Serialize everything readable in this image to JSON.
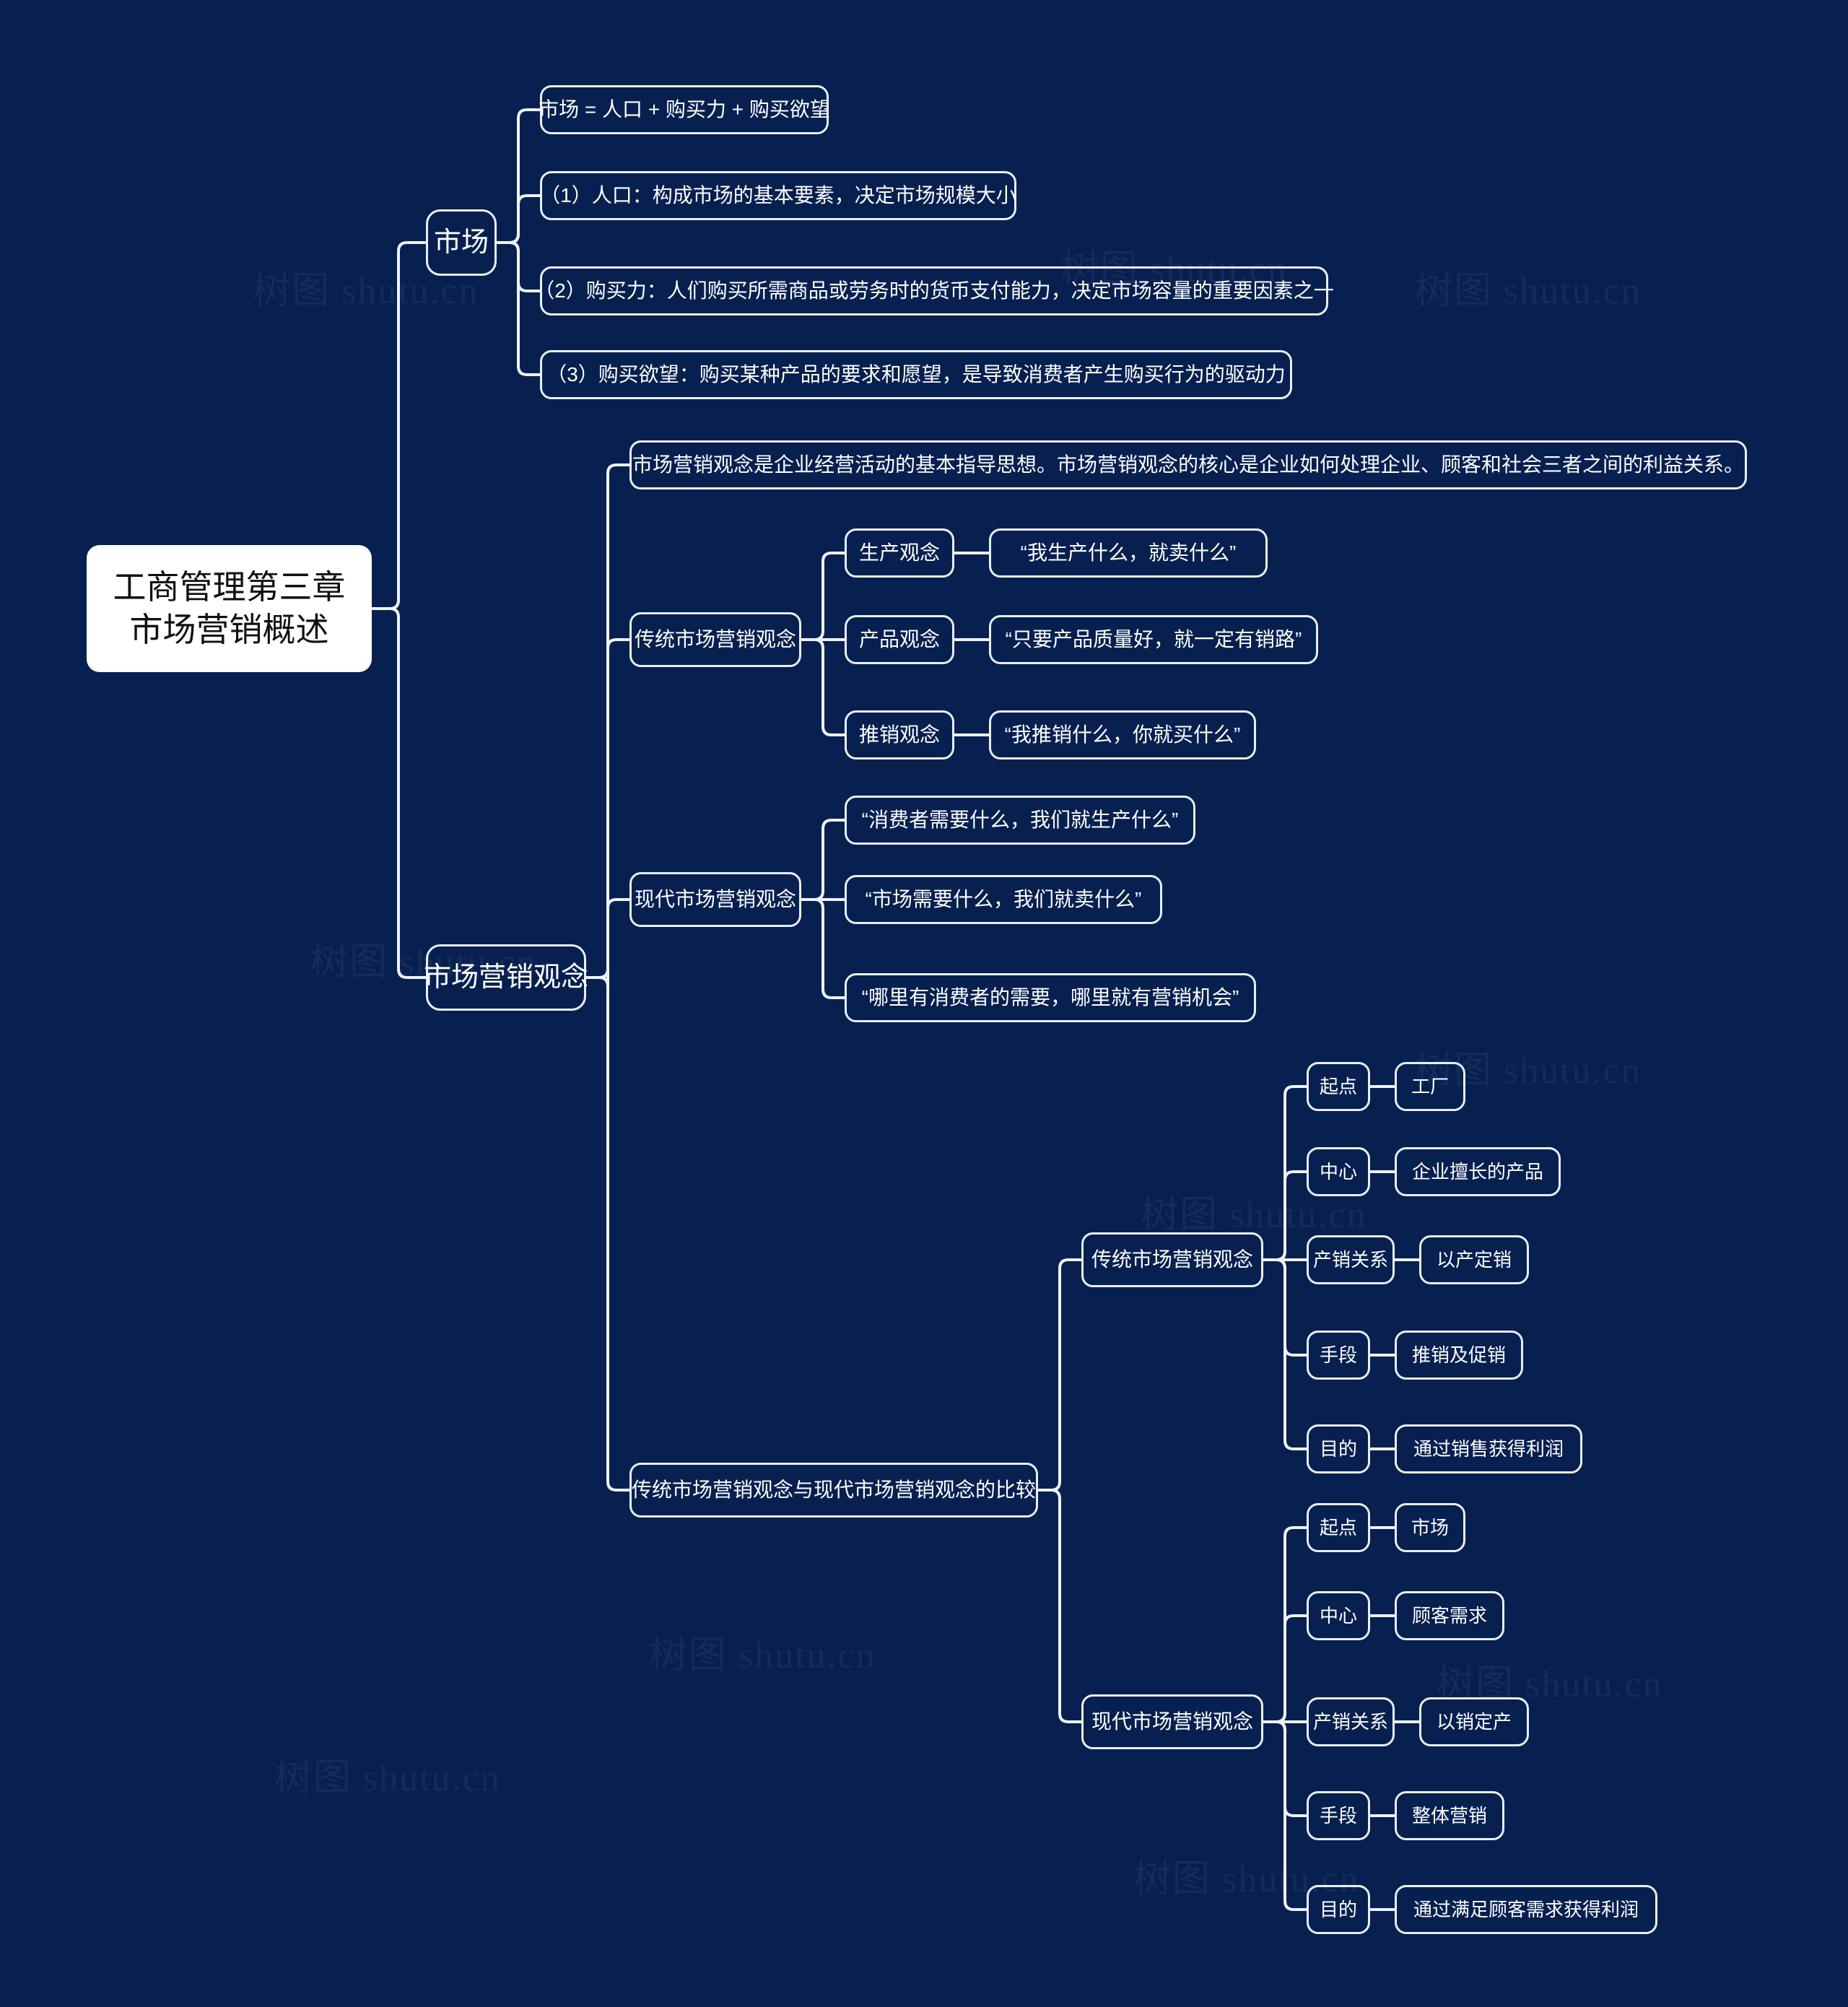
{
  "meta": {
    "background_color": "#07204f",
    "node_border_color": "#e9eef6",
    "node_text_color": "#ffffff",
    "root_background_color": "#ffffff",
    "root_text_color": "#111111",
    "watermark_text": "树图 shutu.cn"
  },
  "root": {
    "line1": "工商管理第三章",
    "line2": "市场营销概述"
  },
  "branches": {
    "market": {
      "label": "市场",
      "children": [
        {
          "label": "市场 = 人口 + 购买力 + 购买欲望"
        },
        {
          "label": "（1）人口：构成市场的基本要素，决定市场规模大小"
        },
        {
          "label": "（2）购买力：人们购买所需商品或劳务时的货币支付能力，决定市场容量的重要因素之一"
        },
        {
          "label": "（3）购买欲望：购买某种产品的要求和愿望，是导致消费者产生购买行为的驱动力"
        }
      ]
    },
    "marketing_concept": {
      "label": "市场营销观念",
      "definition": "市场营销观念是企业经营活动的基本指导思想。市场营销观念的核心是企业如何处理企业、顾客和社会三者之间的利益关系。",
      "traditional": {
        "label": "传统市场营销观念",
        "items": [
          {
            "name": "生产观念",
            "slogan": "“我生产什么，就卖什么”"
          },
          {
            "name": "产品观念",
            "slogan": "“只要产品质量好，就一定有销路”"
          },
          {
            "name": "推销观念",
            "slogan": "“我推销什么，你就买什么”"
          }
        ]
      },
      "modern": {
        "label": "现代市场营销观念",
        "slogans": [
          "“消费者需要什么，我们就生产什么”",
          "“市场需要什么，我们就卖什么”",
          "“哪里有消费者的需要，哪里就有营销机会”"
        ]
      },
      "comparison": {
        "label": "传统市场营销观念与现代市场营销观念的比较",
        "traditional": {
          "label": "传统市场营销观念",
          "rows": [
            {
              "key": "起点",
              "value": "工厂"
            },
            {
              "key": "中心",
              "value": "企业擅长的产品"
            },
            {
              "key": "产销关系",
              "value": "以产定销"
            },
            {
              "key": "手段",
              "value": "推销及促销"
            },
            {
              "key": "目的",
              "value": "通过销售获得利润"
            }
          ]
        },
        "modern": {
          "label": "现代市场营销观念",
          "rows": [
            {
              "key": "起点",
              "value": "市场"
            },
            {
              "key": "中心",
              "value": "顾客需求"
            },
            {
              "key": "产销关系",
              "value": "以销定产"
            },
            {
              "key": "手段",
              "value": "整体营销"
            },
            {
              "key": "目的",
              "value": "通过满足顾客需求获得利润"
            }
          ]
        }
      }
    }
  }
}
